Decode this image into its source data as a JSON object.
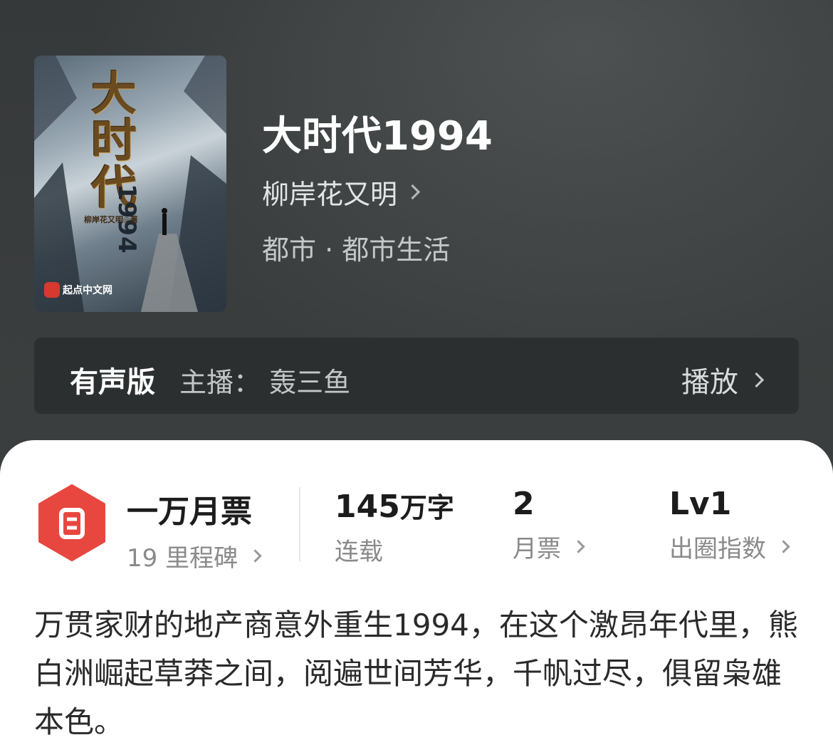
{
  "book": {
    "title": "大时代1994",
    "author": "柳岸花又明",
    "genre": "都市 · 都市生活",
    "cover": {
      "title_text": "大\n时\n代",
      "year_text": "1994",
      "author_text": "柳岸花又明◎著",
      "publisher_text": "起点中文网"
    }
  },
  "audio": {
    "label": "有声版",
    "host": "主播：  轰三鱼",
    "play_label": "播放"
  },
  "stats": {
    "milestone": {
      "value": "一万月票",
      "label": "19 里程碑"
    },
    "words": {
      "value": "145",
      "unit": "万字",
      "label": "连载"
    },
    "monthly_votes": {
      "value": "2",
      "label": "月票"
    },
    "influence": {
      "value": "Lv1",
      "label": "出圈指数"
    }
  },
  "synopsis": "万贯家财的地产商意外重生1994，在这个激昂年代里，熊白洲崛起草莽之间，阅遍世间芳华，千帆过尽，俱留枭雄本色。",
  "colors": {
    "header_bg": "#3a3d3d",
    "audio_bar_bg": "#2c2f30",
    "ticket_red": "#e8473f",
    "card_bg": "#ffffff"
  }
}
